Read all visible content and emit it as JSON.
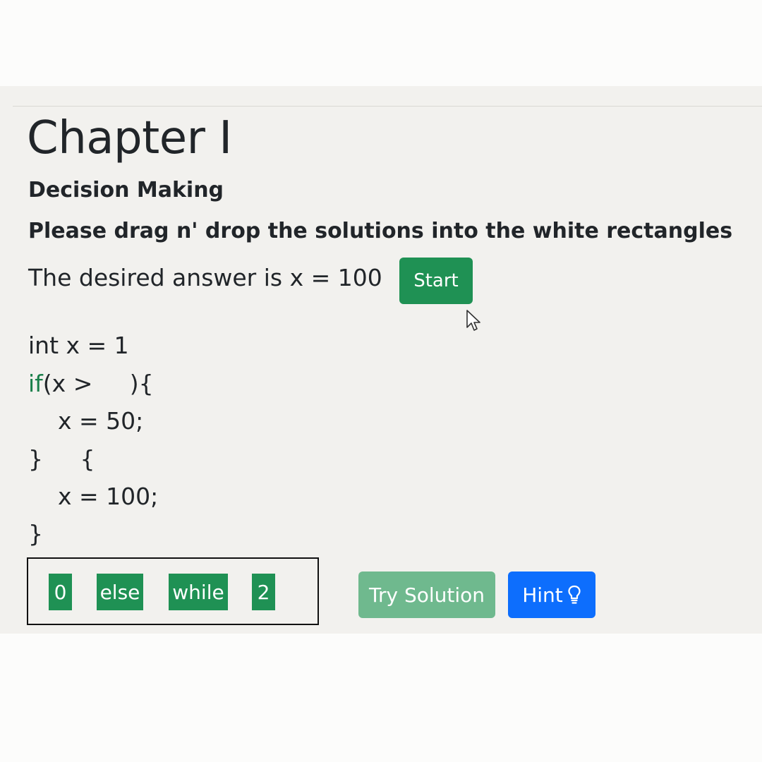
{
  "header": {
    "title": "Chapter I",
    "subtitle": "Decision Making",
    "instruction": "Please drag n' drop the solutions into the white rectangles"
  },
  "task": {
    "desired": "The desired answer is x = 100",
    "start_label": "Start"
  },
  "code": {
    "line1": "int x = 1",
    "line2_kw": "if",
    "line2_rest": "(x >     ){",
    "line3": "    x = 50;",
    "line4": "}     {",
    "line5": "    x = 100;",
    "line6": "}"
  },
  "options": [
    "0",
    "else",
    "while",
    "2"
  ],
  "actions": {
    "try_label": "Try Solution",
    "hint_label": "Hint",
    "hint_icon": "lightbulb-icon"
  },
  "colors": {
    "success": "#1f9154",
    "success_disabled": "#6fb98e",
    "primary": "#0d6efd",
    "keyword": "#1a7f4a"
  }
}
